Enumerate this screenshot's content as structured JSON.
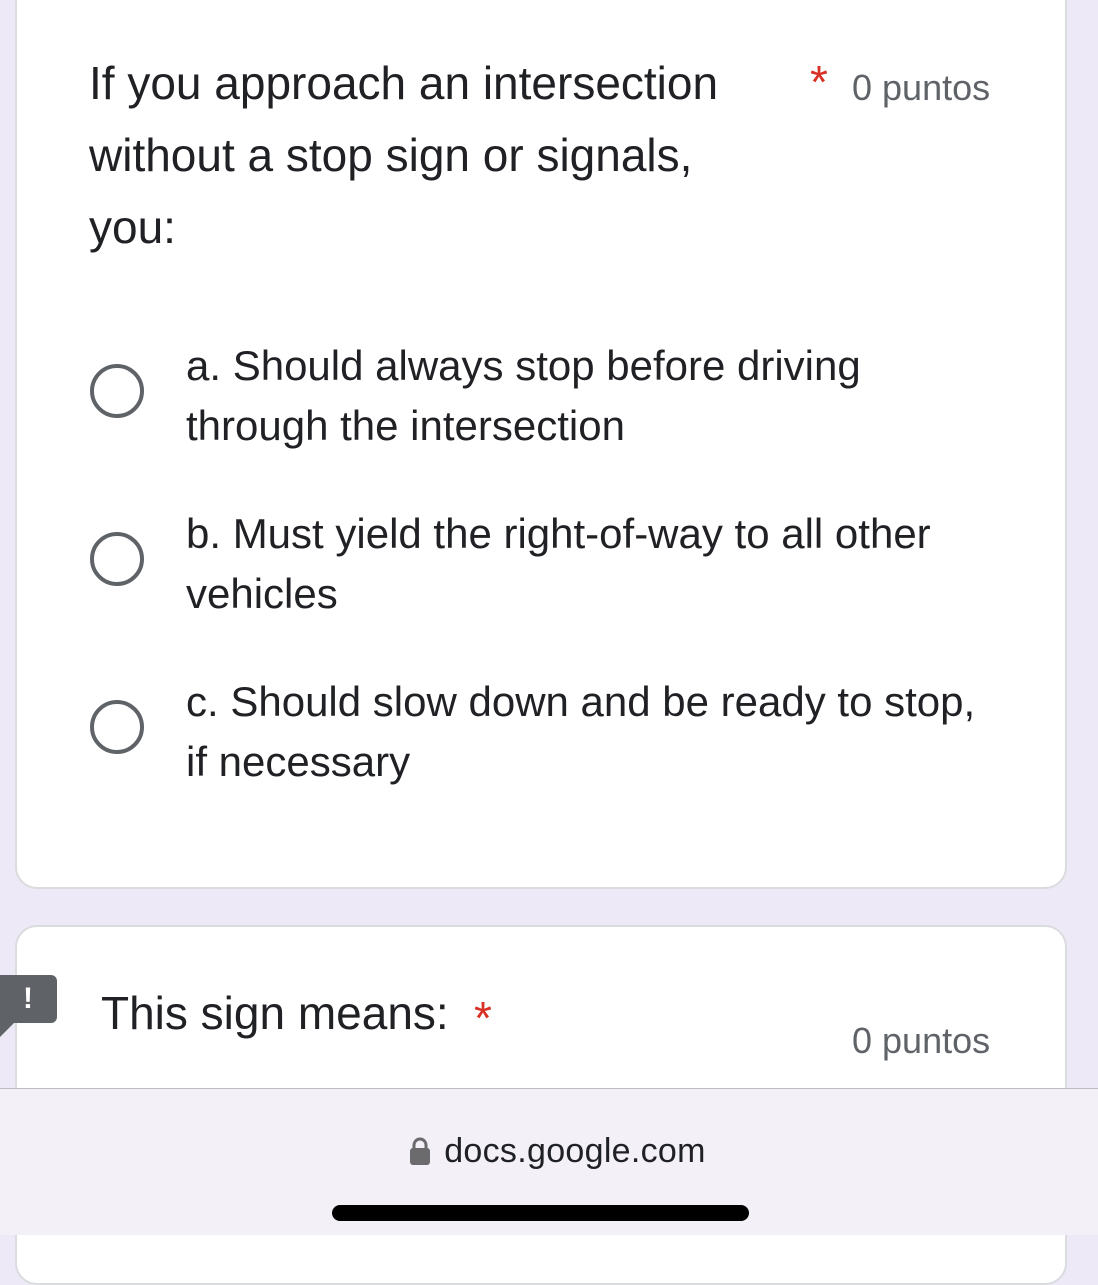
{
  "question1": {
    "title": "If you approach an intersection without a stop sign or signals, you:",
    "required_marker": "*",
    "points": "0 puntos",
    "options": [
      {
        "label": "a. Should always stop before driving through the intersection"
      },
      {
        "label": "b. Must yield the right-of-way to all other vehicles"
      },
      {
        "label": "c. Should slow down and be ready to stop, if necessary"
      }
    ]
  },
  "question2": {
    "title": "This sign means:",
    "required_marker": "*",
    "points": "0 puntos"
  },
  "feedback": {
    "icon": "!"
  },
  "browser": {
    "url": "docs.google.com"
  },
  "colors": {
    "background": "#ede9f6",
    "card": "#ffffff",
    "required": "#d93025",
    "radio_border": "#5f6368",
    "muted_text": "#5f6368"
  },
  "icons": {
    "lock": "lock-icon",
    "feedback": "report-issue-icon"
  }
}
